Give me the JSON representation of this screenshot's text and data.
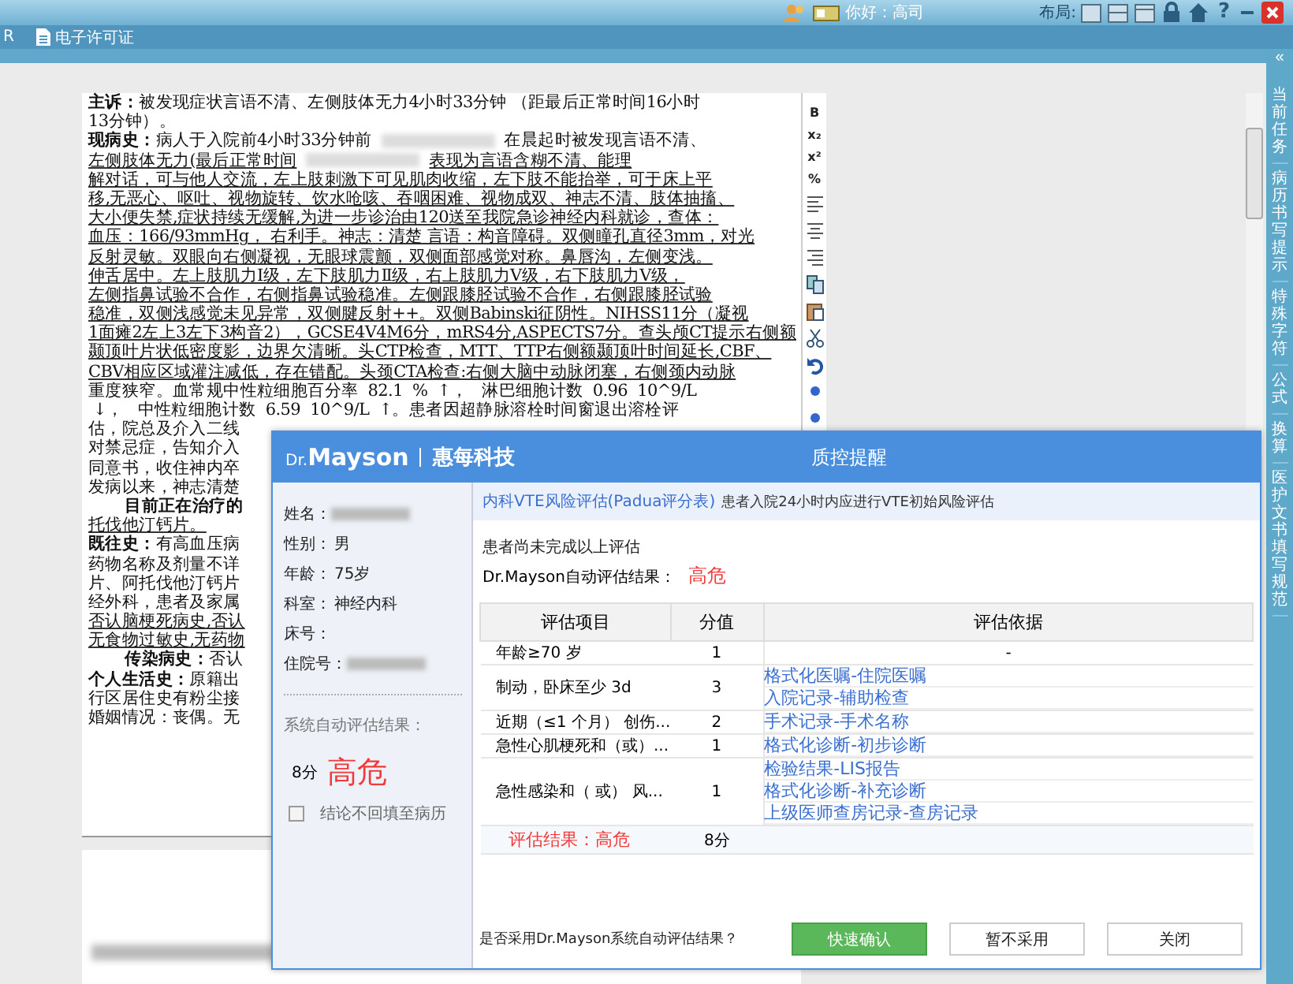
{
  "top_bar": {
    "greeting": "你好：高司",
    "layout_label": "布局:",
    "help": "?"
  },
  "menu_bar": {
    "items": [
      {
        "label": "R",
        "kind": "plain"
      },
      {
        "label": "电子许可证",
        "kind": "document"
      }
    ]
  },
  "document": {
    "toolbar": [
      "B",
      "x₂",
      "x²",
      "%"
    ],
    "lines": [
      {
        "text": "**主诉：**被发现症状言语不清、左侧肢体无力4小时33分钟 （距最后正常时间16小时",
        "underlined": false
      },
      {
        "text": "13分钟）。",
        "underlined": false
      },
      {
        "text": "**现病史：**病人于入院前4小时33分钟前",
        "redacted": true,
        "rest": "在晨起时被发现言语不清、",
        "underlined": false
      },
      {
        "text": "左侧肢体无力(最后正常时间",
        "redacted": true,
        "rest": "表现为言语含糊不清、能理",
        "underlined": true
      },
      {
        "text": "解对话，可与他人交流，左上肢刺激下可见肌肉收缩，左下肢不能抬举，可于床上平",
        "underlined": true
      },
      {
        "text": "移,无恶心、呕吐、视物旋转、饮水呛咳、吞咽困难、视物成双、神志不清、肢体抽搐、",
        "underlined": true
      },
      {
        "text": "大小便失禁,症状持续无缓解,为进一步诊治由120送至我院急诊神经内科就诊，查体：",
        "underlined": true
      },
      {
        "text": "血压：166/93mmHg， 右利手。神志：清楚 言语：构音障碍。双侧瞳孔直径3mm，对光",
        "underlined": true
      },
      {
        "text": "反射灵敏。双眼向右侧凝视，无眼球震颤，双侧面部感觉对称。鼻唇沟，左侧变浅。",
        "underlined": true
      },
      {
        "text": "伸舌居中。左上肢肌力Ⅰ级，左下肢肌力Ⅱ级，右上肢肌力Ⅴ级，右下肢肌力Ⅴ级，",
        "underlined": true
      },
      {
        "text": "左侧指鼻试验不合作，右侧指鼻试验稳准。左侧跟膝胫试验不合作，右侧跟膝胫试验",
        "underlined": true
      },
      {
        "text": "稳准，双侧浅感觉未见异常，双侧腱反射++。双侧Babinski征阴性。NIHSS11分（凝视",
        "underlined": true
      },
      {
        "text": "1面瘫2左上3左下3构音2），GCSE4V4M6分，mRS4分,ASPECTS7分。查头颅CT提示右侧额",
        "underlined": true
      },
      {
        "text": "颞顶叶片状低密度影，边界欠清晰。头CTP检查，MTT、TTP右侧额颞顶叶时间延长,CBF、",
        "underlined": true
      },
      {
        "text": "CBV相应区域灌注减低，存在错配。头颈CTA检查:右侧大脑中动脉闭塞，右侧颈内动脉",
        "underlined": true
      },
      {
        "text": "重度狭窄。血常规中性粒细胞百分率  82.1  %  ↑，   淋巴细胞计数  0.96  10^9/L",
        "underlined": false
      },
      {
        "text": " ↓，   中性粒细胞计数  6.59  10^9/L  ↑。患者因超静脉溶栓时间窗退出溶栓评",
        "underlined": false
      },
      {
        "text": "估，院总及介入二线",
        "underlined": false
      },
      {
        "text": "对禁忌症，告知介入",
        "underlined": false
      },
      {
        "text": "同意书，收住神内卒",
        "underlined": false
      },
      {
        "text": "发病以来，神志清楚",
        "underlined": false
      },
      {
        "text": "**目前正在治疗的**",
        "underlined": false,
        "indent": true
      },
      {
        "text": "托伐他汀钙片。",
        "underlined": true
      },
      {
        "text": "**既往史：**有高血压病",
        "underlined": false
      },
      {
        "text": "药物名称及剂量不详",
        "underlined": false
      },
      {
        "text": "片、阿托伐他汀钙片",
        "underlined": false
      },
      {
        "text": "经外科，患者及家属",
        "underlined": false
      },
      {
        "text": "否认脑梗死病史,否认",
        "underlined": true
      },
      {
        "text": "无食物过敏史,无药物",
        "underlined": true
      },
      {
        "text": "**传染病史：**否认",
        "underlined": false,
        "indent": true
      },
      {
        "text": "**个人生活史：**原籍出",
        "underlined": false
      },
      {
        "text": "行区居住史有粉尘接",
        "underlined": false
      },
      {
        "text": "婚姻情况：丧偶。无",
        "underlined": false
      }
    ]
  },
  "sidebar": {
    "collapse": "«",
    "tabs": [
      "当前任务",
      "病历书写提示",
      "特殊字符",
      "公式",
      "换算",
      "医护文书填写规范"
    ]
  },
  "dialog": {
    "brand_prefix": "Dr.",
    "brand": "Mayson",
    "company": "惠每科技",
    "title": "质控提醒",
    "patient": [
      {
        "label": "姓名：",
        "redacted": true
      },
      {
        "label": "性别：",
        "value": "男"
      },
      {
        "label": "年龄：",
        "value": "75岁"
      },
      {
        "label": "科室：",
        "value": "神经内科"
      },
      {
        "label": "床号："
      },
      {
        "label": "住院号：",
        "redacted": true
      }
    ],
    "system_result_label": "系统自动评估结果：",
    "system_score": "8分",
    "system_level": "高危",
    "writeback": {
      "label": "结论不回填至病历",
      "checked": false
    },
    "assessment": {
      "name": "内科VTE风险评估(Padua评分表)",
      "hint": "患者入院24小时内应进行VTE初始风险评估"
    },
    "status": "患者尚未完成以上评估",
    "auto_label": "Dr.Mayson自动评估结果：",
    "auto_level": "高危",
    "table": {
      "columns": [
        "评估项目",
        "分值",
        "评估依据"
      ],
      "rows": [
        {
          "item": "年龄≥70 岁",
          "score": "1",
          "basis": [
            {
              "text": "-",
              "kind": "plain"
            }
          ]
        },
        {
          "item": "制动，卧床至少 3d",
          "score": "3",
          "basis": [
            {
              "text": "格式化医嘱-住院医嘱",
              "kind": "link"
            },
            {
              "text": "入院记录-辅助检查",
              "kind": "link"
            }
          ]
        },
        {
          "item": "近期（≤1 个月） 创伤...",
          "score": "2",
          "basis": [
            {
              "text": "手术记录-手术名称",
              "kind": "link"
            }
          ]
        },
        {
          "item": "急性心肌梗死和（或）...",
          "score": "1",
          "basis": [
            {
              "text": "格式化诊断-初步诊断",
              "kind": "link"
            }
          ]
        },
        {
          "item": "急性感染和（ 或） 风...",
          "score": "1",
          "basis": [
            {
              "text": "检验结果-LIS报告",
              "kind": "link"
            },
            {
              "text": "格式化诊断-补充诊断",
              "kind": "link"
            },
            {
              "text": "上级医师查房记录-查房记录",
              "kind": "link"
            }
          ]
        }
      ]
    },
    "result_label": "评估结果：高危",
    "result_score": "8分",
    "question": "是否采用Dr.Mayson系统自动评估结果？",
    "buttons": [
      {
        "label": "快速确认",
        "kind": "primary"
      },
      {
        "label": "暂不采用",
        "kind": "default"
      },
      {
        "label": "关闭",
        "kind": "default"
      }
    ]
  }
}
